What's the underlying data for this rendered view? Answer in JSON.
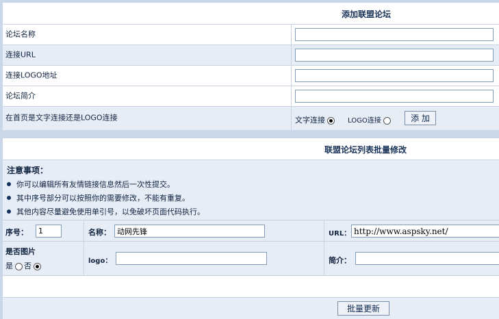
{
  "add_form": {
    "title": "添加联盟论坛",
    "fields": [
      {
        "label": "论坛名称",
        "value": ""
      },
      {
        "label": "连接URL",
        "value": ""
      },
      {
        "label": "连接LOGO地址",
        "value": ""
      },
      {
        "label": "论坛简介",
        "value": ""
      }
    ],
    "link_type": {
      "label": "在首页是文字连接还是LOGO连接",
      "options": [
        {
          "label": "文字连接",
          "selected": true
        },
        {
          "label": "LOGO连接",
          "selected": false
        }
      ]
    },
    "add_button": "添 加"
  },
  "list_form": {
    "title": "联盟论坛列表批量修改",
    "notes_title": "注意事项：",
    "notes": [
      "你可以编辑所有友情链接信息然后一次性提交。",
      "其中序号部分可以按照你的需要修改，不能有重复。",
      "其他内容尽量避免使用单引号，以免破坏页面代码执行。"
    ],
    "item": {
      "seq_label": "序号：",
      "seq_value": "1",
      "name_label": "名称：",
      "name_value": "动网先锋",
      "url_label": "URL：",
      "url_value": "http://www.aspsky.net/",
      "is_image_label": "是否图片",
      "yes_label": "是",
      "no_label": "否",
      "is_image": false,
      "logo_label": "logo：",
      "logo_value": "",
      "intro_label": "简介：",
      "intro_value": ""
    },
    "update_button": "批量更新"
  }
}
